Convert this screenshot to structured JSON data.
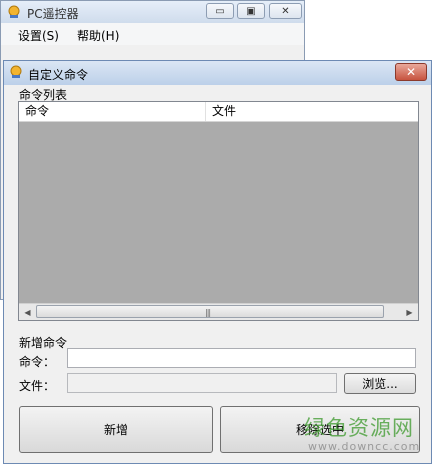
{
  "background_window": {
    "title": "PC遥控器",
    "min_symbol": "▭",
    "max_symbol": "▣",
    "close_symbol": "✕",
    "menu": [
      "设置(S)",
      "帮助(H)"
    ]
  },
  "dialog": {
    "title": "自定义命令",
    "close_symbol": "✕",
    "command_list": {
      "group_label": "命令列表",
      "columns": [
        "命令",
        "文件"
      ],
      "rows": []
    },
    "scrollbar": {
      "left_arrow": "◀",
      "right_arrow": "▶",
      "grip": "|||"
    },
    "new_command": {
      "group_label": "新增命令",
      "command_label": "命令：",
      "command_value": "",
      "file_label": "文件：",
      "file_value": "",
      "browse_label": "浏览..."
    },
    "buttons": {
      "add": "新增",
      "remove": "移除选中"
    }
  },
  "watermark": {
    "text": "绿色资源网",
    "url": "www.downcc.com"
  },
  "colors": {
    "list_background": "#ababab",
    "dialog_background": "#f0f0f0",
    "close_button": "#c7533f",
    "watermark": "#3d9a2d"
  }
}
